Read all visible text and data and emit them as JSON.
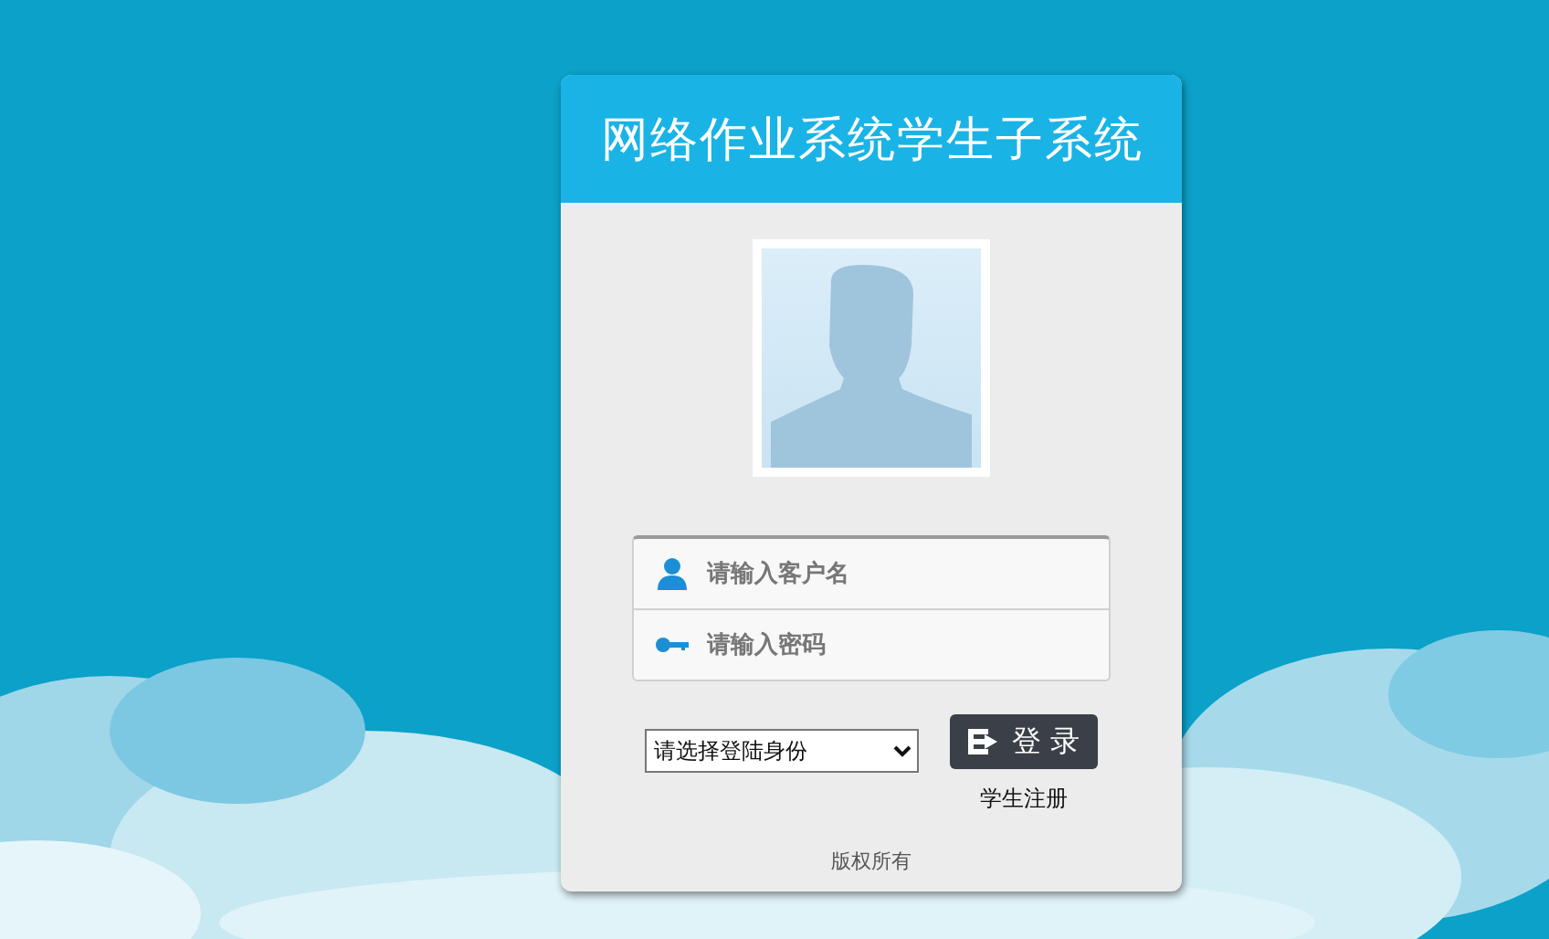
{
  "title": "网络作业系统学生子系统",
  "fields": [
    {
      "kind": "user",
      "placeholder": "请输入客户名"
    },
    {
      "kind": "key",
      "placeholder": "请输入密码"
    }
  ],
  "role_select": {
    "value": "请选择登陆身份"
  },
  "login_button": {
    "label": "登 录"
  },
  "register_link": "学生注册",
  "footer": "版权所有"
}
